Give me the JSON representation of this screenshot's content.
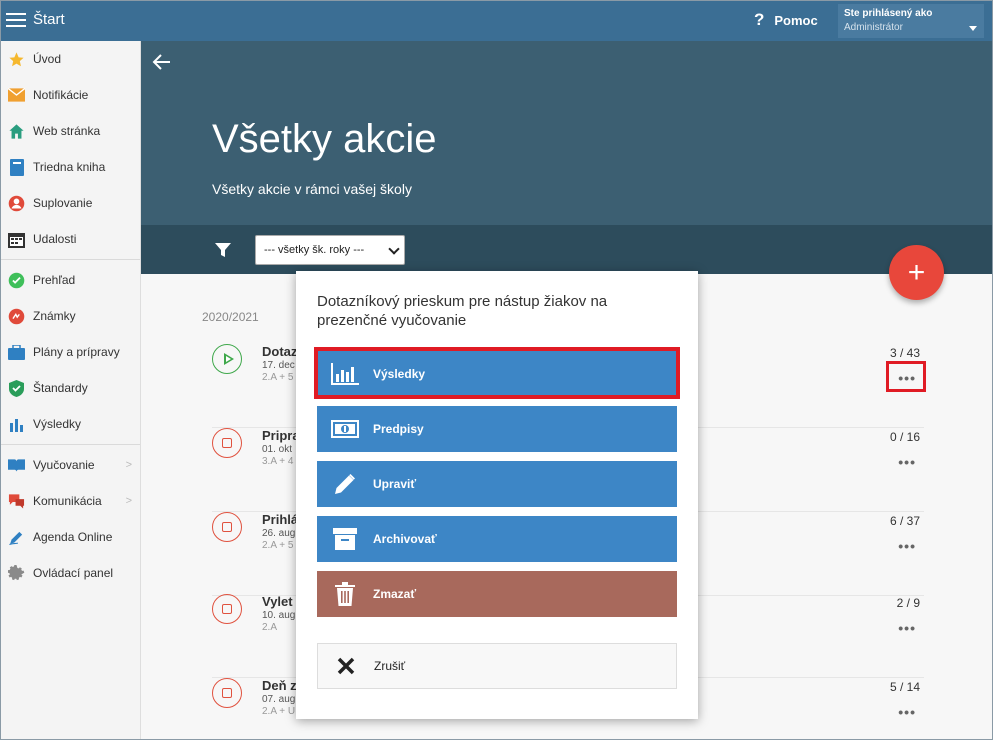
{
  "topbar": {
    "title": "Štart",
    "help_label": "Pomoc",
    "help_icon": "?",
    "user_line1": "Ste prihlásený ako",
    "user_line2": "Administrátor"
  },
  "sidebar": {
    "items": [
      {
        "label": "Úvod",
        "icon": "star-icon"
      },
      {
        "label": "Notifikácie",
        "icon": "envelope-icon"
      },
      {
        "label": "Web stránka",
        "icon": "home-icon"
      },
      {
        "label": "Triedna kniha",
        "icon": "book-icon"
      },
      {
        "label": "Suplovanie",
        "icon": "person-icon"
      },
      {
        "label": "Udalosti",
        "icon": "calendar-icon"
      },
      {
        "label": "Prehľad",
        "icon": "check-circle-icon"
      },
      {
        "label": "Známky",
        "icon": "grade-icon"
      },
      {
        "label": "Plány a prípravy",
        "icon": "briefcase-icon"
      },
      {
        "label": "Štandardy",
        "icon": "shield-icon"
      },
      {
        "label": "Výsledky",
        "icon": "bar-chart-icon"
      },
      {
        "label": "Vyučovanie",
        "icon": "open-book-icon"
      },
      {
        "label": "Komunikácia",
        "icon": "chat-icon"
      },
      {
        "label": "Agenda Online",
        "icon": "pen-icon"
      },
      {
        "label": "Ovládací panel",
        "icon": "gear-icon"
      }
    ]
  },
  "hero": {
    "title": "Všetky akcie",
    "subtitle": "Všetky akcie v rámci vašej školy"
  },
  "filter": {
    "year_select_value": "--- všetky šk. roky ---"
  },
  "list": {
    "year": "2020/2021",
    "events": [
      {
        "title": "Dotaz",
        "date": "17. dec",
        "classes": "2.A + 5",
        "count": "3 / 43",
        "status": "play"
      },
      {
        "title": "Pripra",
        "date": "01. okt",
        "classes": "3.A + 4",
        "count": "0 / 16",
        "status": "stop"
      },
      {
        "title": "Prihlá",
        "date": "26. aug",
        "classes": "2.A + 5",
        "count": "6 / 37",
        "status": "stop"
      },
      {
        "title": "Vylet",
        "date": "10. aug",
        "classes": "2.A",
        "count": "2 / 9",
        "status": "stop"
      },
      {
        "title": "Deň z",
        "date": "07. aug",
        "classes": "2.A + U",
        "count": "5 / 14",
        "status": "stop"
      }
    ]
  },
  "modal": {
    "title": "Dotazníkový prieskum pre nástup žiakov na prezenčné vyučovanie",
    "buttons": {
      "results": "Výsledky",
      "regulations": "Predpisy",
      "edit": "Upraviť",
      "archive": "Archivovať",
      "delete": "Zmazať",
      "cancel": "Zrušiť"
    }
  },
  "colors": {
    "topbar": "#3b6e94",
    "hero": "#3c5f72",
    "filterbar": "#2d4c5c",
    "button_blue": "#3d86c6",
    "button_delete": "#a8695c",
    "fab": "#e8473b",
    "highlight": "#e01b24"
  }
}
